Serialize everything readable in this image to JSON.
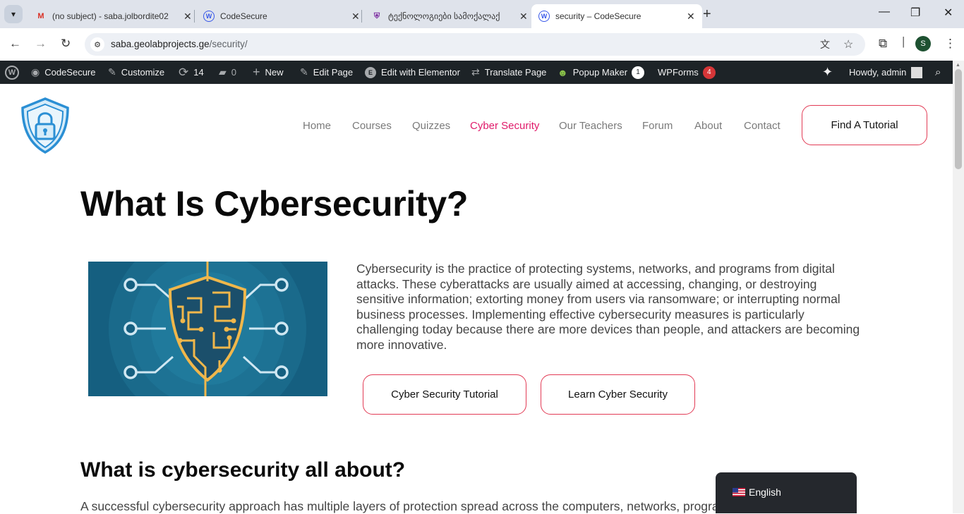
{
  "browser": {
    "tabs": [
      {
        "title": "(no subject) - saba.jolbordite02",
        "favicon": "gmail-icon"
      },
      {
        "title": "CodeSecure",
        "favicon": "wordpress-icon"
      },
      {
        "title": "ტექნოლოგიები სამოქალაქ",
        "favicon": "shield-crest-icon"
      },
      {
        "title": "security – CodeSecure",
        "favicon": "wordpress-icon"
      }
    ],
    "url_host": "saba.geolabprojects.ge",
    "url_path": "/security/",
    "profile_initial": "S"
  },
  "adminbar": {
    "site_name": "CodeSecure",
    "customize": "Customize",
    "updates_count": "14",
    "comments_count": "0",
    "new_label": "New",
    "edit_page": "Edit Page",
    "edit_elementor": "Edit with Elementor",
    "translate_page": "Translate Page",
    "popup_maker": "Popup Maker",
    "popup_badge": "1",
    "wpforms": "WPForms",
    "wpforms_badge": "4",
    "howdy": "Howdy, admin"
  },
  "nav": {
    "items": [
      "Home",
      "Courses",
      "Quizzes",
      "Cyber Security",
      "Our Teachers",
      "Forum",
      "About",
      "Contact"
    ],
    "cta": "Find A Tutorial"
  },
  "main": {
    "title": "What Is Cybersecurity?",
    "intro": "Cybersecurity is the practice of protecting systems, networks, and programs from digital attacks. These cyberattacks are usually aimed at accessing, changing, or destroying sensitive information; extorting money from users via ransomware; or interrupting normal business processes. Implementing effective cybersecurity measures is particularly challenging today because there are more devices than people, and attackers are becoming more innovative.",
    "button_tutorial": "Cyber Security Tutorial",
    "button_learn": "Learn Cyber Security",
    "subheading": "What is cybersecurity all about?",
    "body": "A successful cybersecurity approach has multiple layers of protection spread across the computers, networks, programs"
  },
  "language": {
    "label": "English"
  },
  "colors": {
    "accent": "#e01a6a",
    "button_border": "#e23b55",
    "adminbar": "#1d2327"
  }
}
